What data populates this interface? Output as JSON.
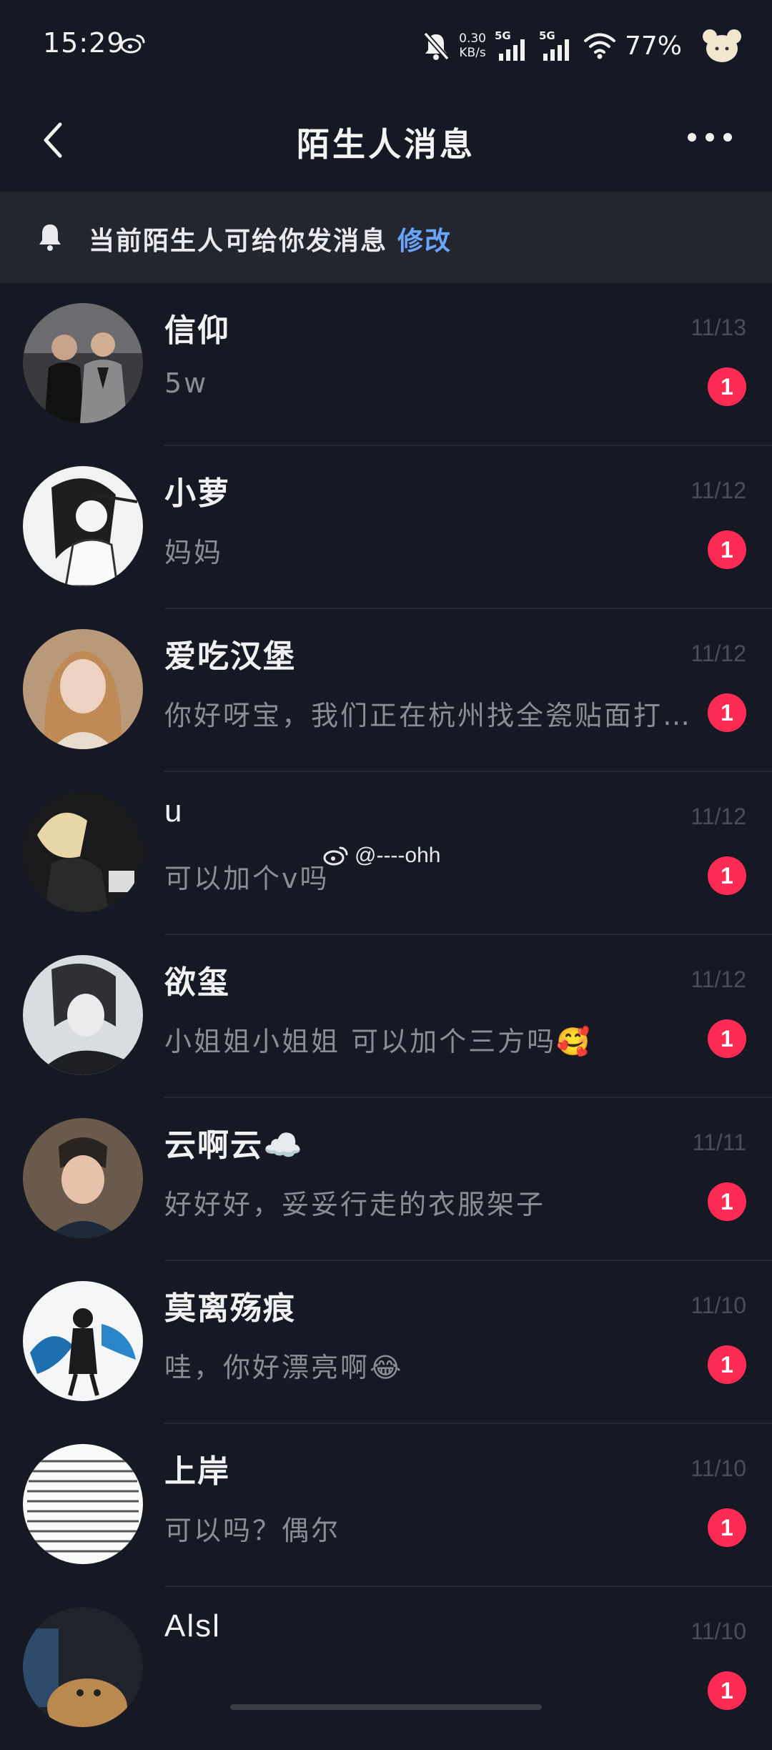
{
  "status_bar": {
    "time": "15:29",
    "net_speed_value": "0.30",
    "net_speed_unit": "KB/s",
    "sim1": "5G",
    "sim2": "5G",
    "battery": "77%"
  },
  "header": {
    "title": "陌生人消息",
    "back_icon": "chevron-left-icon",
    "more_icon": "more-horizontal-icon"
  },
  "notice": {
    "text": "当前陌生人可给你发消息",
    "link": "修改",
    "icon": "bell-icon"
  },
  "conversations": [
    {
      "name": "信仰",
      "date": "11/13",
      "preview": "5w",
      "unread": "1"
    },
    {
      "name": "小萝",
      "date": "11/12",
      "preview": "妈妈",
      "unread": "1"
    },
    {
      "name": "爱吃汉堡",
      "date": "11/12",
      "preview": "你好呀宝，我们正在杭州找全瓷贴面打…",
      "unread": "1"
    },
    {
      "name": "u",
      "date": "11/12",
      "preview": "可以加个v吗",
      "unread": "1"
    },
    {
      "name": "欲玺",
      "date": "11/12",
      "preview": "小姐姐小姐姐  可以加个三方吗🥰",
      "unread": "1"
    },
    {
      "name": "云啊云☁️",
      "date": "11/11",
      "preview": "好好好，妥妥行走的衣服架子",
      "unread": "1"
    },
    {
      "name": "莫离殇痕",
      "date": "11/10",
      "preview": "哇，你好漂亮啊😂",
      "unread": "1"
    },
    {
      "name": "上岸",
      "date": "11/10",
      "preview": "可以吗？偶尔",
      "unread": "1"
    },
    {
      "name": "Alsl",
      "date": "11/10",
      "preview": "",
      "unread": "1"
    }
  ],
  "watermark": "@----ohh",
  "colors": {
    "background": "#161823",
    "notice_bg": "#24262f",
    "accent_link": "#6aa5ff",
    "badge": "#fe2c55"
  }
}
